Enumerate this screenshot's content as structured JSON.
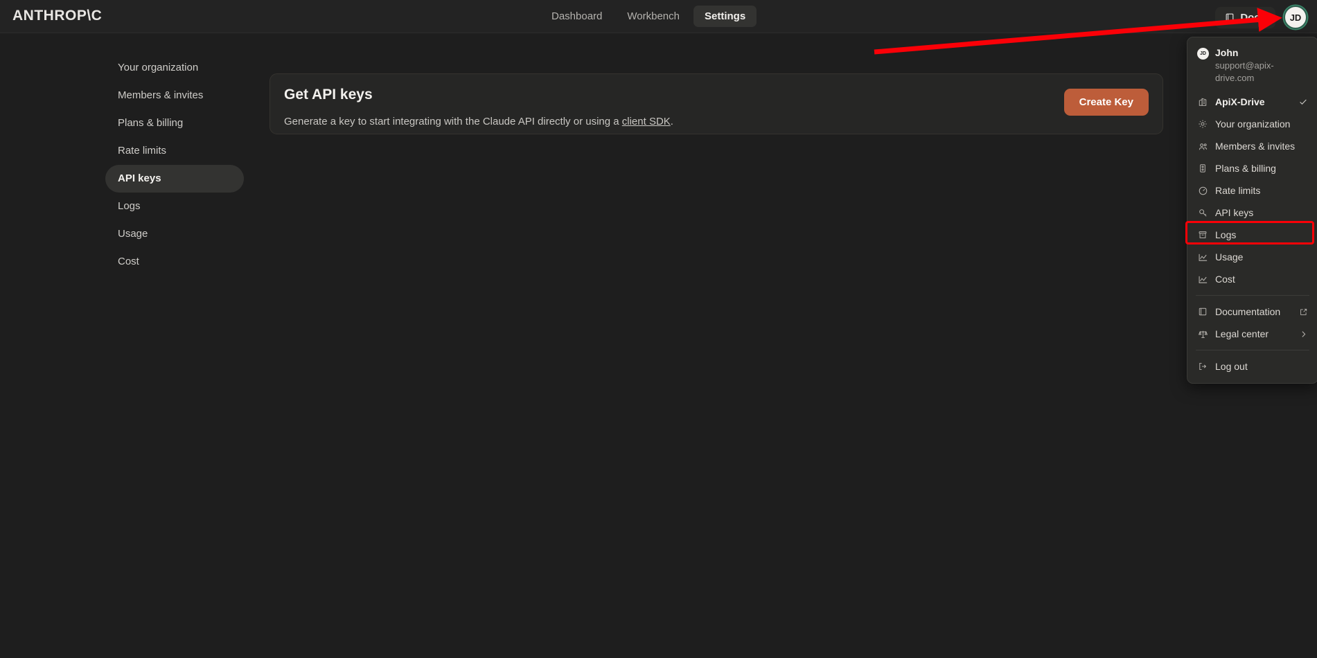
{
  "app": {
    "logo": "ANTHROP\\C",
    "theme_bg": "#1e1e1e",
    "accent": "#bd5d3a",
    "annotation_color": "#fb0007"
  },
  "topnav": {
    "items": [
      {
        "label": "Dashboard",
        "active": false
      },
      {
        "label": "Workbench",
        "active": false
      },
      {
        "label": "Settings",
        "active": true
      }
    ],
    "docs_label": "Docs",
    "docs_icon": "book-icon",
    "avatar_initials": "JD"
  },
  "sidebar": {
    "items": [
      {
        "label": "Your organization",
        "active": false
      },
      {
        "label": "Members & invites",
        "active": false
      },
      {
        "label": "Plans & billing",
        "active": false
      },
      {
        "label": "Rate limits",
        "active": false
      },
      {
        "label": "API keys",
        "active": true
      },
      {
        "label": "Logs",
        "active": false
      },
      {
        "label": "Usage",
        "active": false
      },
      {
        "label": "Cost",
        "active": false
      }
    ]
  },
  "card": {
    "title": "Get API keys",
    "desc_before": "Generate a key to start integrating with the Claude API directly or using a ",
    "desc_link": "client SDK",
    "desc_after": ".",
    "button_label": "Create Key"
  },
  "menu": {
    "user_initials": "JD",
    "user_name": "John",
    "user_email": "support@apix-drive.com",
    "org": {
      "label": "ApiX-Drive",
      "icon": "building-icon",
      "checked": true
    },
    "items": [
      {
        "label": "Your organization",
        "icon": "gear-icon"
      },
      {
        "label": "Members & invites",
        "icon": "people-icon"
      },
      {
        "label": "Plans & billing",
        "icon": "traffic-light-icon"
      },
      {
        "label": "Rate limits",
        "icon": "gauge-icon"
      },
      {
        "label": "API keys",
        "icon": "key-icon",
        "highlighted": true
      },
      {
        "label": "Logs",
        "icon": "archive-icon"
      },
      {
        "label": "Usage",
        "icon": "line-chart-icon"
      },
      {
        "label": "Cost",
        "icon": "line-chart-icon"
      }
    ],
    "items2": [
      {
        "label": "Documentation",
        "icon": "book-icon",
        "trail": "external-link-icon"
      },
      {
        "label": "Legal center",
        "icon": "scales-icon",
        "trail": "chevron-right-icon"
      }
    ],
    "logout": {
      "label": "Log out",
      "icon": "logout-icon"
    }
  }
}
